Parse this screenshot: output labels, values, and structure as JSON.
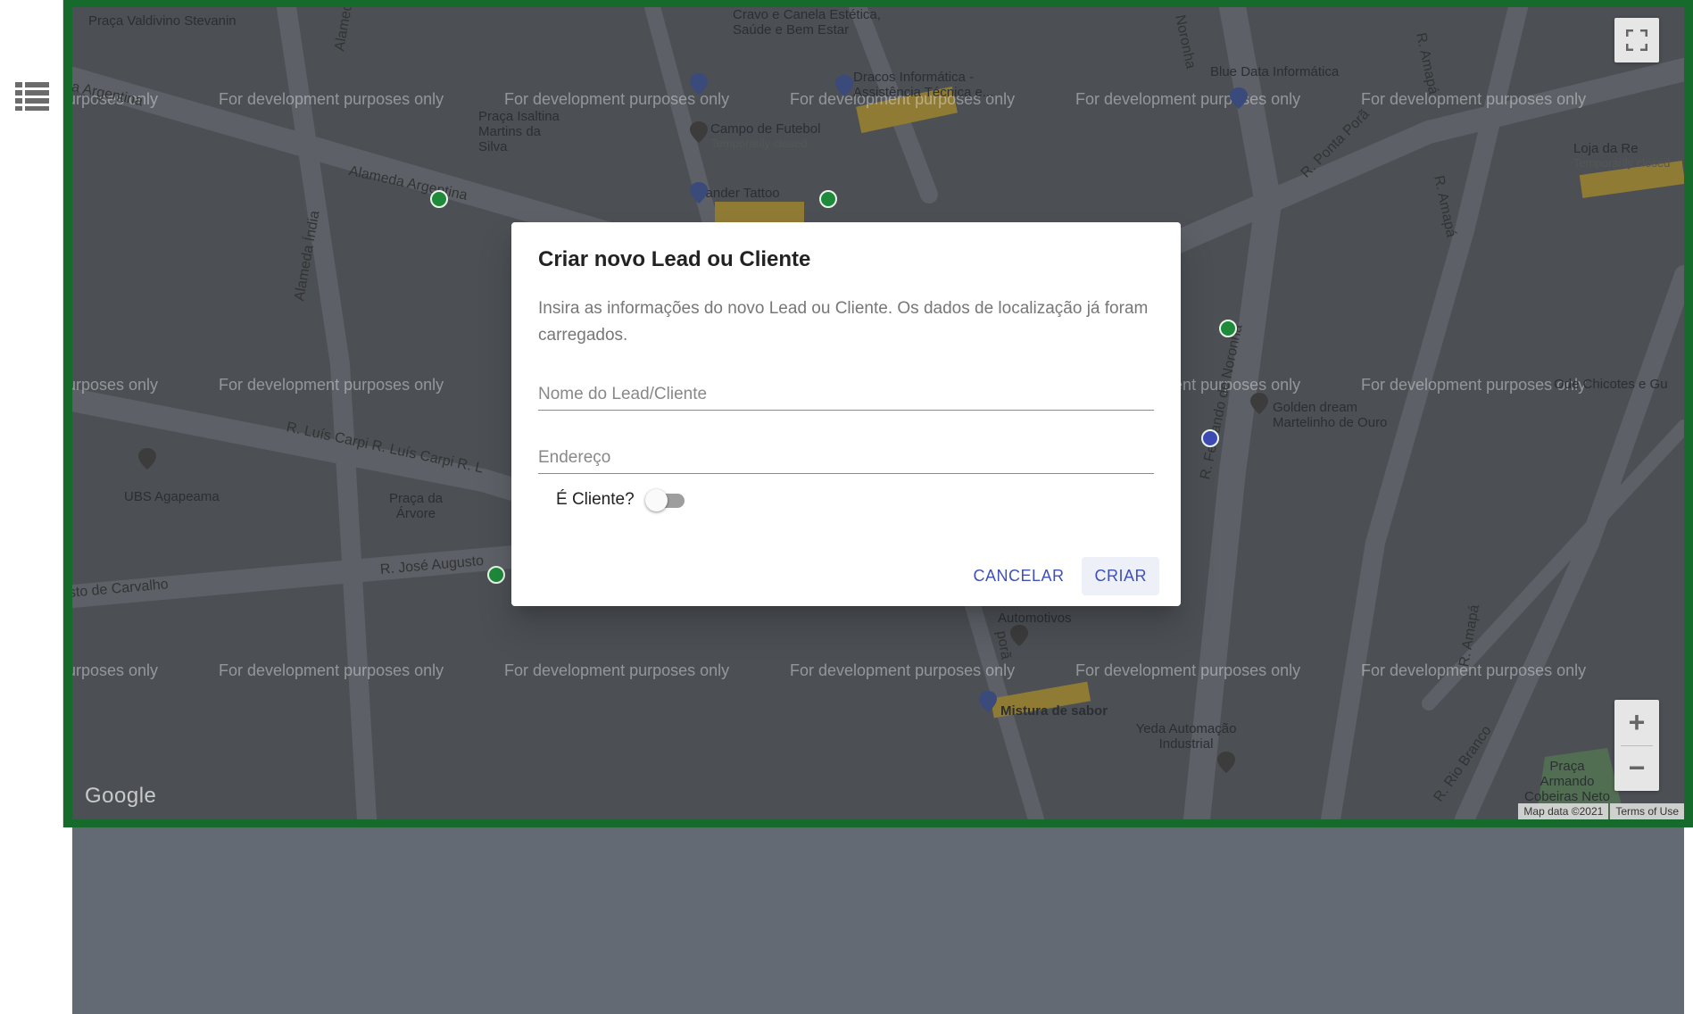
{
  "sidebar": {
    "items": [
      {
        "icon": "list-icon",
        "color": "#6b6b6b"
      },
      {
        "icon": "map-icon",
        "color": "#1e8a3a"
      }
    ]
  },
  "map": {
    "dev_watermark": "For development purposes only",
    "labels": {
      "praca_valdivino": "Praça Valdivino Stevanin",
      "alameda_top": "Alameda",
      "clinic": "Cravo e Canela Estética, Saúde e Bem Estar",
      "noronha_top": "Noronha",
      "r_amapa_top": "R. Amapá",
      "alameda_argentina_left": "la Argentina",
      "praca_isaltina": "Praça Isaltina Martins da Silva",
      "dracos": "Dracos Informática - Assistência Técnica e...",
      "blue_data": "Blue Data Informática",
      "campo_futebol": "Campo de Futebol",
      "temp_closed": "Temporarily closed",
      "r_ponta_pora": "R. Ponta Porã",
      "loja_re": "Loja da Re",
      "thander": "Thander Tattoo",
      "alameda_argentina": "Alameda Argentina",
      "alameda_india": "Alameda Índia",
      "r_amapa_right": "R. Amapá",
      "ubs": "UBS Agapeama",
      "praca_arvore": "Praça da Árvore",
      "r_luis_carpi": "R. Luís Carpi R. Luís Carpi R. L",
      "golden_dream": "Golden dream Martelinho de Ouro",
      "chicotes": "Ode Chicotes e Gu",
      "r_jose_augusto": "R. José Augusto",
      "carvalho": "sto de Carvalho",
      "automotivos": "Automotivos",
      "mistura": "Mistura de sabor",
      "yeda": "Yeda Automação Industrial",
      "praca_armando": "Praça Armando Cobeiras Neto",
      "r_rio_branco": "R. Rio Branco",
      "r_amapa_bottom": "R. Amapá",
      "r_fernando": "R. Fernando de Noronha",
      "pore": "porã"
    },
    "google_logo": "Google",
    "map_data": "Map data ©2021",
    "terms": "Terms of Use",
    "zoom_in": "+",
    "zoom_out": "−"
  },
  "dialog": {
    "title": "Criar novo Lead ou Cliente",
    "description": "Insira as informações do novo Lead ou Cliente. Os dados de localização já foram carregados.",
    "name_placeholder": "Nome do Lead/Cliente",
    "address_placeholder": "Endereço",
    "is_client_label": "É Cliente?",
    "is_client": false,
    "cancel_label": "CANCELAR",
    "create_label": "CRIAR"
  },
  "colors": {
    "accent": "#3f51b5",
    "frame": "#156a2c",
    "marker_green": "#1e8a3a",
    "marker_blue": "#3f4bb5"
  }
}
